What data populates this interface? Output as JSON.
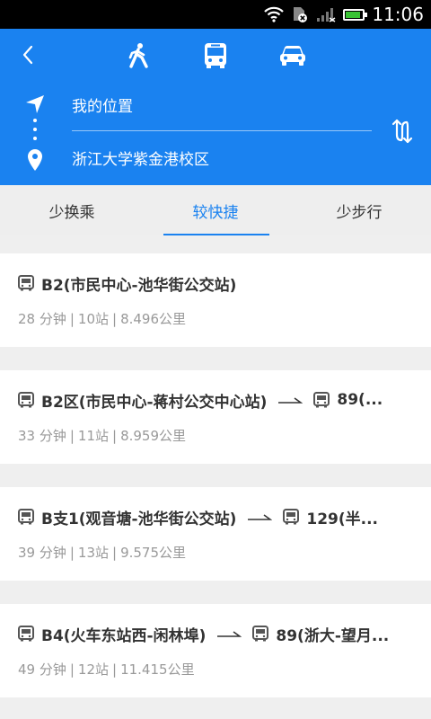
{
  "status_bar": {
    "time": "11:06",
    "battery_level": 0.85
  },
  "header": {
    "modes": [
      {
        "name": "walk",
        "icon": "walk-icon"
      },
      {
        "name": "bus",
        "icon": "bus-icon"
      },
      {
        "name": "car",
        "icon": "car-icon"
      }
    ],
    "active_mode": "bus",
    "from": "我的位置",
    "to": "浙江大学紫金港校区"
  },
  "tabs": [
    "少换乘",
    "较快捷",
    "少步行"
  ],
  "active_tab": 1,
  "routes": [
    {
      "lines": [
        "B2(市民中心-池华街公交站)"
      ],
      "duration": "28 分钟",
      "stops": "10站",
      "distance": "8.496公里"
    },
    {
      "lines": [
        "B2区(市民中心-蒋村公交中心站)",
        "89(..."
      ],
      "duration": "33 分钟",
      "stops": "11站",
      "distance": "8.959公里"
    },
    {
      "lines": [
        "B支1(观音塘-池华街公交站)",
        "129(半..."
      ],
      "duration": "39 分钟",
      "stops": "13站",
      "distance": "9.575公里"
    },
    {
      "lines": [
        "B4(火车东站西-闲林埠)",
        "89(浙大-望月..."
      ],
      "duration": "49 分钟",
      "stops": "12站",
      "distance": "11.415公里"
    }
  ],
  "colors": {
    "primary": "#1a82f0",
    "meta_text": "#999999",
    "title_text": "#333333"
  }
}
